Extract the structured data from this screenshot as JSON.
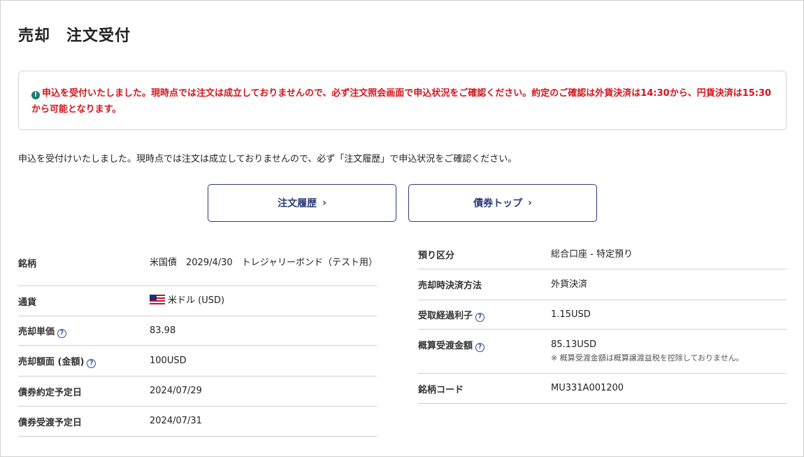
{
  "page": {
    "title": "売却　注文受付"
  },
  "alert": {
    "icon": "alert-circle-icon",
    "message": "申込を受付いたしました。現時点では注文は成立しておりませんので、必ず注文照会画面で申込状況をご確認ください。約定のご確認は外貨決済は14:30から、円貨決済は15:30から可能となります。",
    "color": "#d3141d"
  },
  "info": {
    "message": "申込を受付けいたしました。現時点では注文は成立しておりませんので、必ず「注文履歴」で申込状況をご確認ください。"
  },
  "buttons": {
    "history_label": "注文履歴",
    "top_label": "債券トップ",
    "chevron": "›",
    "accent": "#2b3a77"
  },
  "left_table": {
    "rows": [
      {
        "label": "銘柄",
        "value": "米国債　2029/4/30　トレジャリーボンド（テスト用）"
      },
      {
        "label": "通貨",
        "value": "米ドル (USD)",
        "icon": "us-flag-icon"
      },
      {
        "label": "売却単価",
        "value": "83.98",
        "help": true
      },
      {
        "label": "売却額面 (金額)",
        "value": "100USD",
        "help": true
      },
      {
        "label": "債券約定予定日",
        "value": "2024/07/29"
      },
      {
        "label": "債券受渡予定日",
        "value": "2024/07/31"
      }
    ]
  },
  "right_table": {
    "rows": [
      {
        "label": "預り区分",
        "value": "総合口座 - 特定預り"
      },
      {
        "label": "売却時決済方法",
        "value": "外貨決済"
      },
      {
        "label": "受取経過利子",
        "value": "1.15USD",
        "help": true
      },
      {
        "label": "概算受渡金額",
        "value": "85.13USD",
        "help": true,
        "note": "※ 概算受渡金額は概算譲渡益税を控除しておりません。"
      },
      {
        "label": "銘柄コード",
        "value": "MU331A001200"
      }
    ]
  },
  "help_glyph": "?"
}
